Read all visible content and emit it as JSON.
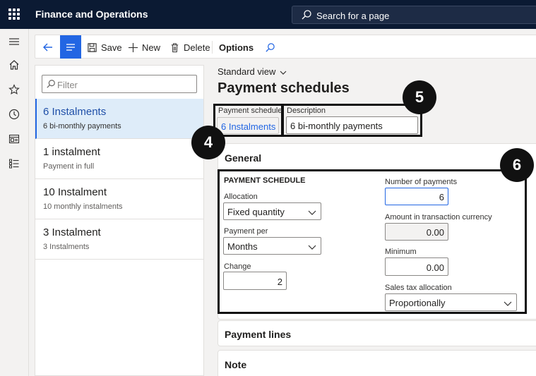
{
  "app": {
    "title": "Finance and Operations"
  },
  "search": {
    "placeholder": "Search for a page"
  },
  "toolbar": {
    "save_label": "Save",
    "new_label": "New",
    "delete_label": "Delete",
    "options_label": "Options"
  },
  "filter": {
    "placeholder": "Filter"
  },
  "list": {
    "items": [
      {
        "title": "6 Instalments",
        "subtitle": "6 bi-monthly payments"
      },
      {
        "title": "1 instalment",
        "subtitle": "Payment in full"
      },
      {
        "title": "10 Instalment",
        "subtitle": "10 monthly instalments"
      },
      {
        "title": "3 Instalment",
        "subtitle": "3 Instalments"
      }
    ]
  },
  "header": {
    "view_label": "Standard view",
    "page_title": "Payment schedules",
    "payment_schedule_label": "Payment schedule",
    "payment_schedule_value": "6 Instalments",
    "description_label": "Description",
    "description_value": "6 bi-monthly payments"
  },
  "general": {
    "title": "General",
    "section_heading": "PAYMENT SCHEDULE",
    "allocation_label": "Allocation",
    "allocation_value": "Fixed quantity",
    "payment_per_label": "Payment per",
    "payment_per_value": "Months",
    "change_label": "Change",
    "change_value": "2",
    "num_payments_label": "Number of payments",
    "num_payments_value": "6",
    "amount_label": "Amount in transaction currency",
    "amount_value": "0.00",
    "minimum_label": "Minimum",
    "minimum_value": "0.00",
    "sales_tax_label": "Sales tax allocation",
    "sales_tax_value": "Proportionally"
  },
  "fasttabs": {
    "payment_lines": "Payment lines",
    "note": "Note"
  },
  "callouts": {
    "c4": "4",
    "c5": "5",
    "c6": "6"
  },
  "colors": {
    "topbar": "#0b1a33",
    "accent": "#2266e3",
    "selected_bg": "#deecf9"
  }
}
